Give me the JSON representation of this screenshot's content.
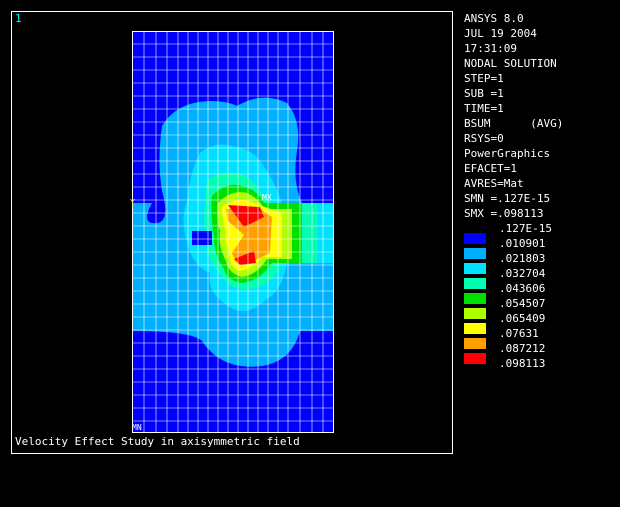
{
  "viewport": {
    "window_number": "1",
    "caption": "Velocity Effect Study in axisymmetric field",
    "axis_label_y": "Y",
    "axis_label_x": "X",
    "max_marker": "MX",
    "min_marker": "MN"
  },
  "info": {
    "lines": [
      "ANSYS 8.0",
      "JUL 19 2004",
      "17:31:09",
      "NODAL SOLUTION",
      "STEP=1",
      "SUB =1",
      "TIME=1",
      "BSUM      (AVG)",
      "RSYS=0",
      "PowerGraphics",
      "EFACET=1",
      "AVRES=Mat",
      "SMN =.127E-15",
      "SMX =.098113"
    ]
  },
  "legend": {
    "values": [
      ".127E-15",
      ".010901",
      ".021803",
      ".032704",
      ".043606",
      ".054507",
      ".065409",
      ".07631",
      ".087212",
      ".098113"
    ],
    "colors": [
      "#0000ff",
      "#00b0ff",
      "#00e0ff",
      "#00ffb0",
      "#00e000",
      "#b0ff00",
      "#ffff00",
      "#ffa000",
      "#ff0000"
    ]
  },
  "colors": {
    "background": "#000000",
    "frame": "#ffffff",
    "mesh": "#ffffff",
    "window_number": "#00ffff"
  }
}
